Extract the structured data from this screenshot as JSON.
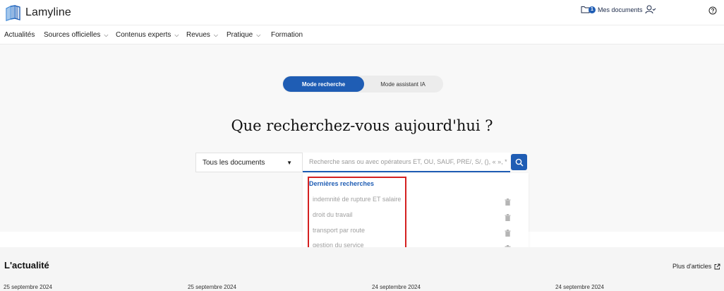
{
  "app": {
    "name": "Lamyline"
  },
  "header": {
    "docs_count": "1",
    "docs_label": "Mes documents"
  },
  "nav": {
    "items": [
      {
        "label": "Actualités",
        "dropdown": false
      },
      {
        "label": "Sources officielles",
        "dropdown": true
      },
      {
        "label": "Contenus experts",
        "dropdown": true
      },
      {
        "label": "Revues",
        "dropdown": true
      },
      {
        "label": "Pratique",
        "dropdown": true
      },
      {
        "label": "Formation",
        "dropdown": false
      }
    ]
  },
  "search": {
    "mode_active": "Mode recherche",
    "mode_inactive": "Mode assistant IA",
    "headline": "Que recherchez-vous aujourd'hui ?",
    "doc_type": "Tous les documents",
    "placeholder": "Recherche sans ou avec opérateurs ET, OU, SAUF, PRE/, S/, (), « », *"
  },
  "recent": {
    "title": "Dernières recherches",
    "items": [
      "indemnité de rupture ET salaire",
      "droit du travail",
      "transport par route",
      "gestion du service"
    ]
  },
  "news": {
    "title": "L'actualité",
    "more_label": "Plus d'articles",
    "dates": [
      "25 septembre 2024",
      "25 septembre 2024",
      "24 septembre 2024",
      "24 septembre 2024"
    ]
  },
  "colors": {
    "accent": "#1f5db4",
    "highlight": "#d42020"
  }
}
